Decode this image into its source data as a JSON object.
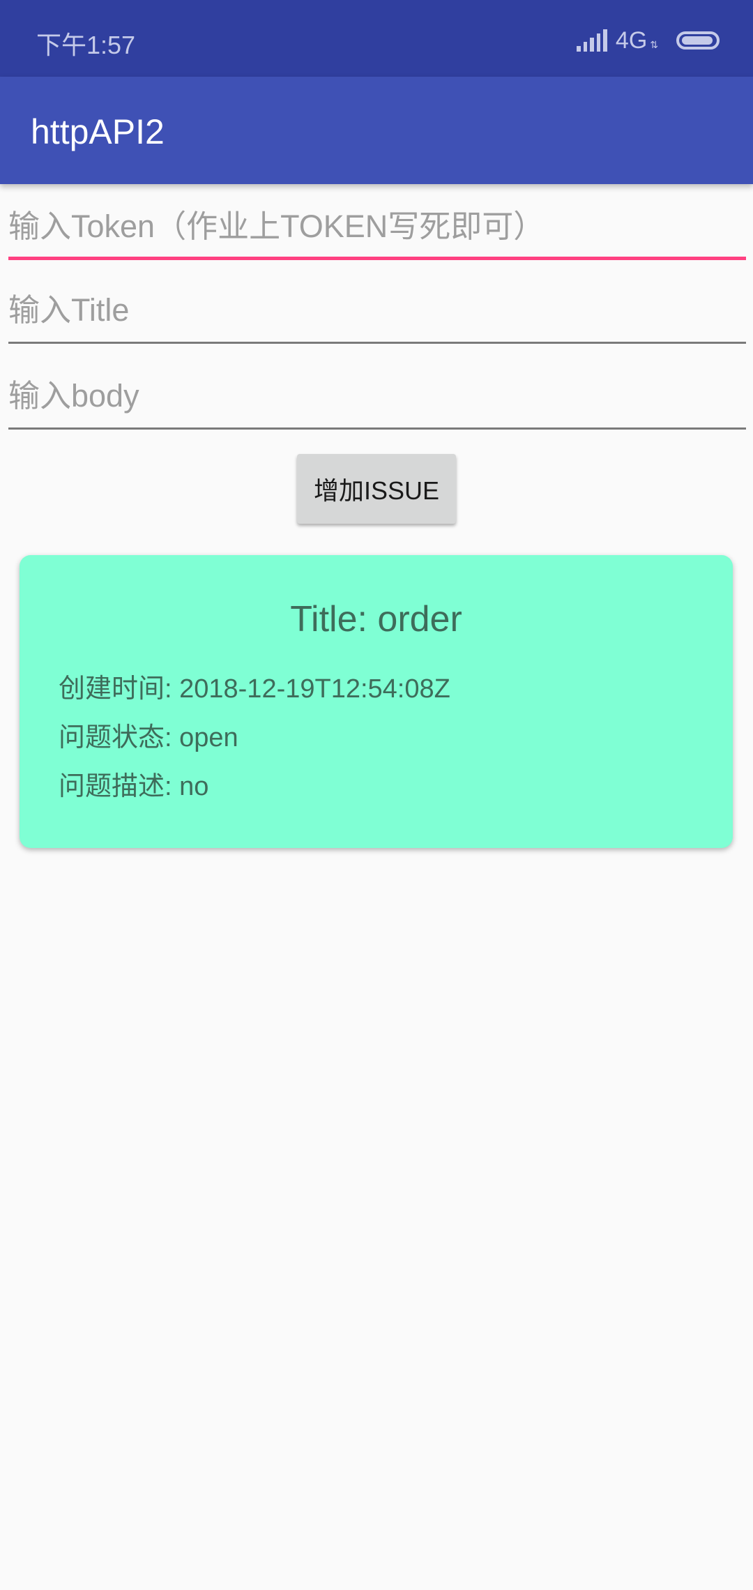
{
  "status_bar": {
    "time": "下午1:57",
    "network": "4G",
    "network_arrows": "⇅",
    "icons": [
      "signal-icon",
      "battery-icon"
    ]
  },
  "app_bar": {
    "title": "httpAPI2"
  },
  "form": {
    "token_placeholder": "输入Token（作业上TOKEN写死即可）",
    "title_placeholder": "输入Title",
    "body_placeholder": "输入body",
    "add_button_label": "增加ISSUE"
  },
  "issue_card": {
    "title": "Title: order",
    "created_at": "创建时间: 2018-12-19T12:54:08Z",
    "state": "问题状态: open",
    "description": "问题描述: no"
  },
  "colors": {
    "status_bar": "#303f9f",
    "app_bar": "#3f51b5",
    "accent": "#ff4081",
    "card": "#7fffd4",
    "background": "#fafafa"
  }
}
